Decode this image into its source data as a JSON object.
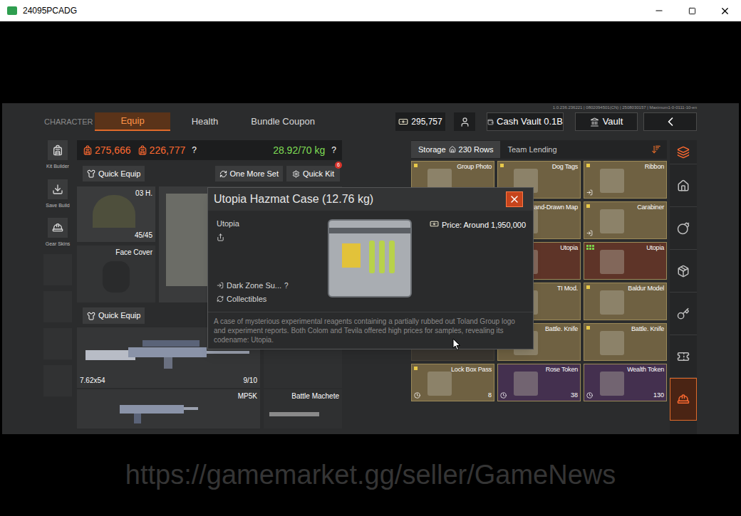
{
  "window": {
    "title": "24095PCADG"
  },
  "top_nav": {
    "section": "CHARACTER",
    "tabs": [
      {
        "label": "Equip",
        "selected": true
      },
      {
        "label": "Health",
        "selected": false
      },
      {
        "label": "Bundle Coupon",
        "selected": false
      }
    ],
    "currency": "295,757",
    "cash_vault": "Cash Vault 0.1B",
    "vault": "Vault",
    "version": "1.0.236.236221 | 0802094501(CN) | 2508030157 | Maximum1-0-0111-10-en"
  },
  "left_tools": [
    {
      "label": "Kit Builder"
    },
    {
      "label": "Save Build"
    },
    {
      "label": "Gear Skins"
    }
  ],
  "equip": {
    "value_a": "275,666",
    "value_b": "226,777",
    "value_help": "?",
    "weight": "28.92/70 kg",
    "weight_help": "?",
    "quick_equip": "Quick Equip",
    "one_more_set": "One More Set",
    "quick_kit": "Quick Kit",
    "quick_kit_badge": "6",
    "helmet": {
      "label": "03 H.",
      "durability": "45/45"
    },
    "face_cover": "Face Cover",
    "quick_equip_2": "Quick Equip",
    "primary": {
      "ammo": "7.62x54",
      "mag": "9/10"
    },
    "secondary": "MP5K",
    "melee": "Battle Machete"
  },
  "storage": {
    "tabs": [
      {
        "label": "Storage",
        "count": "230 Rows",
        "selected": true
      },
      {
        "label": "Team Lending",
        "selected": false
      }
    ],
    "items": [
      {
        "name": "Group Photo",
        "color": "#6f6142",
        "mark": "yellow",
        "transfer": false,
        "timed": false,
        "count": "",
        "covered": false
      },
      {
        "name": "Dog Tags",
        "color": "#6f6142",
        "mark": "yellow",
        "transfer": false,
        "timed": false,
        "count": "",
        "covered": false
      },
      {
        "name": "Ribbon",
        "color": "#6f6142",
        "mark": "yellow",
        "transfer": true,
        "timed": false,
        "count": "",
        "covered": false
      },
      {
        "name": "",
        "color": "#6f6142",
        "mark": "none",
        "transfer": false,
        "timed": false,
        "count": "",
        "covered": true
      },
      {
        "name": "Hand-Drawn Map",
        "color": "#6f6142",
        "mark": "none",
        "transfer": false,
        "timed": false,
        "count": "",
        "covered": false
      },
      {
        "name": "Carabiner",
        "color": "#6f6142",
        "mark": "yellow",
        "transfer": true,
        "timed": false,
        "count": "",
        "covered": false
      },
      {
        "name": "",
        "color": "#6f6142",
        "mark": "none",
        "transfer": false,
        "timed": false,
        "count": "",
        "covered": true
      },
      {
        "name": "Utopia",
        "color": "#5e3428",
        "mark": "none",
        "transfer": false,
        "timed": false,
        "count": "",
        "covered": false
      },
      {
        "name": "Utopia",
        "color": "#5e3428",
        "mark": "green",
        "transfer": false,
        "timed": false,
        "count": "",
        "covered": false
      },
      {
        "name": "",
        "color": "#6f6142",
        "mark": "none",
        "transfer": false,
        "timed": false,
        "count": "",
        "covered": true
      },
      {
        "name": "TI Mod.",
        "color": "#6f6142",
        "mark": "yellow",
        "transfer": false,
        "timed": false,
        "count": "",
        "covered": false
      },
      {
        "name": "Baldur Model",
        "color": "#6f6142",
        "mark": "yellow",
        "transfer": false,
        "timed": false,
        "count": "",
        "covered": false
      },
      {
        "name": "",
        "color": "#6f6142",
        "mark": "none",
        "transfer": false,
        "timed": false,
        "count": "",
        "covered": true
      },
      {
        "name": "Battle. Knife",
        "color": "#6f6142",
        "mark": "none",
        "transfer": false,
        "timed": false,
        "count": "",
        "covered": false
      },
      {
        "name": "Battle. Knife",
        "color": "#6f6142",
        "mark": "yellow",
        "transfer": false,
        "timed": false,
        "count": "",
        "covered": false
      },
      {
        "name": "Lock Box Pass",
        "color": "#6f6142",
        "mark": "yellow",
        "transfer": false,
        "timed": true,
        "count": "8",
        "covered": false
      },
      {
        "name": "Rose Token",
        "color": "#44304f",
        "mark": "none",
        "transfer": false,
        "timed": true,
        "count": "38",
        "covered": false
      },
      {
        "name": "Wealth Token",
        "color": "#44304f",
        "mark": "none",
        "transfer": false,
        "timed": true,
        "count": "130",
        "covered": false
      }
    ]
  },
  "sidebar": [
    {
      "kind": "header",
      "selected": false
    },
    {
      "kind": "item",
      "selected": false
    },
    {
      "kind": "item",
      "selected": false
    },
    {
      "kind": "item",
      "selected": false
    },
    {
      "kind": "item",
      "selected": false
    },
    {
      "kind": "item",
      "selected": false
    },
    {
      "kind": "item",
      "selected": true
    }
  ],
  "popup": {
    "title": "Utopia Hazmat Case (12.76 kg)",
    "subtitle": "Utopia",
    "price": "Price: Around 1,950,000",
    "source": "Dark Zone Su...",
    "source_help": "?",
    "category": "Collectibles",
    "description": "A case of mysterious experimental reagents containing a partially rubbed out Toland Group logo and experiment reports. Both Colom and Tevila offered high prices for samples, revealing its codename: Utopia."
  },
  "watermark": "https://gamemarket.gg/seller/GameNews"
}
